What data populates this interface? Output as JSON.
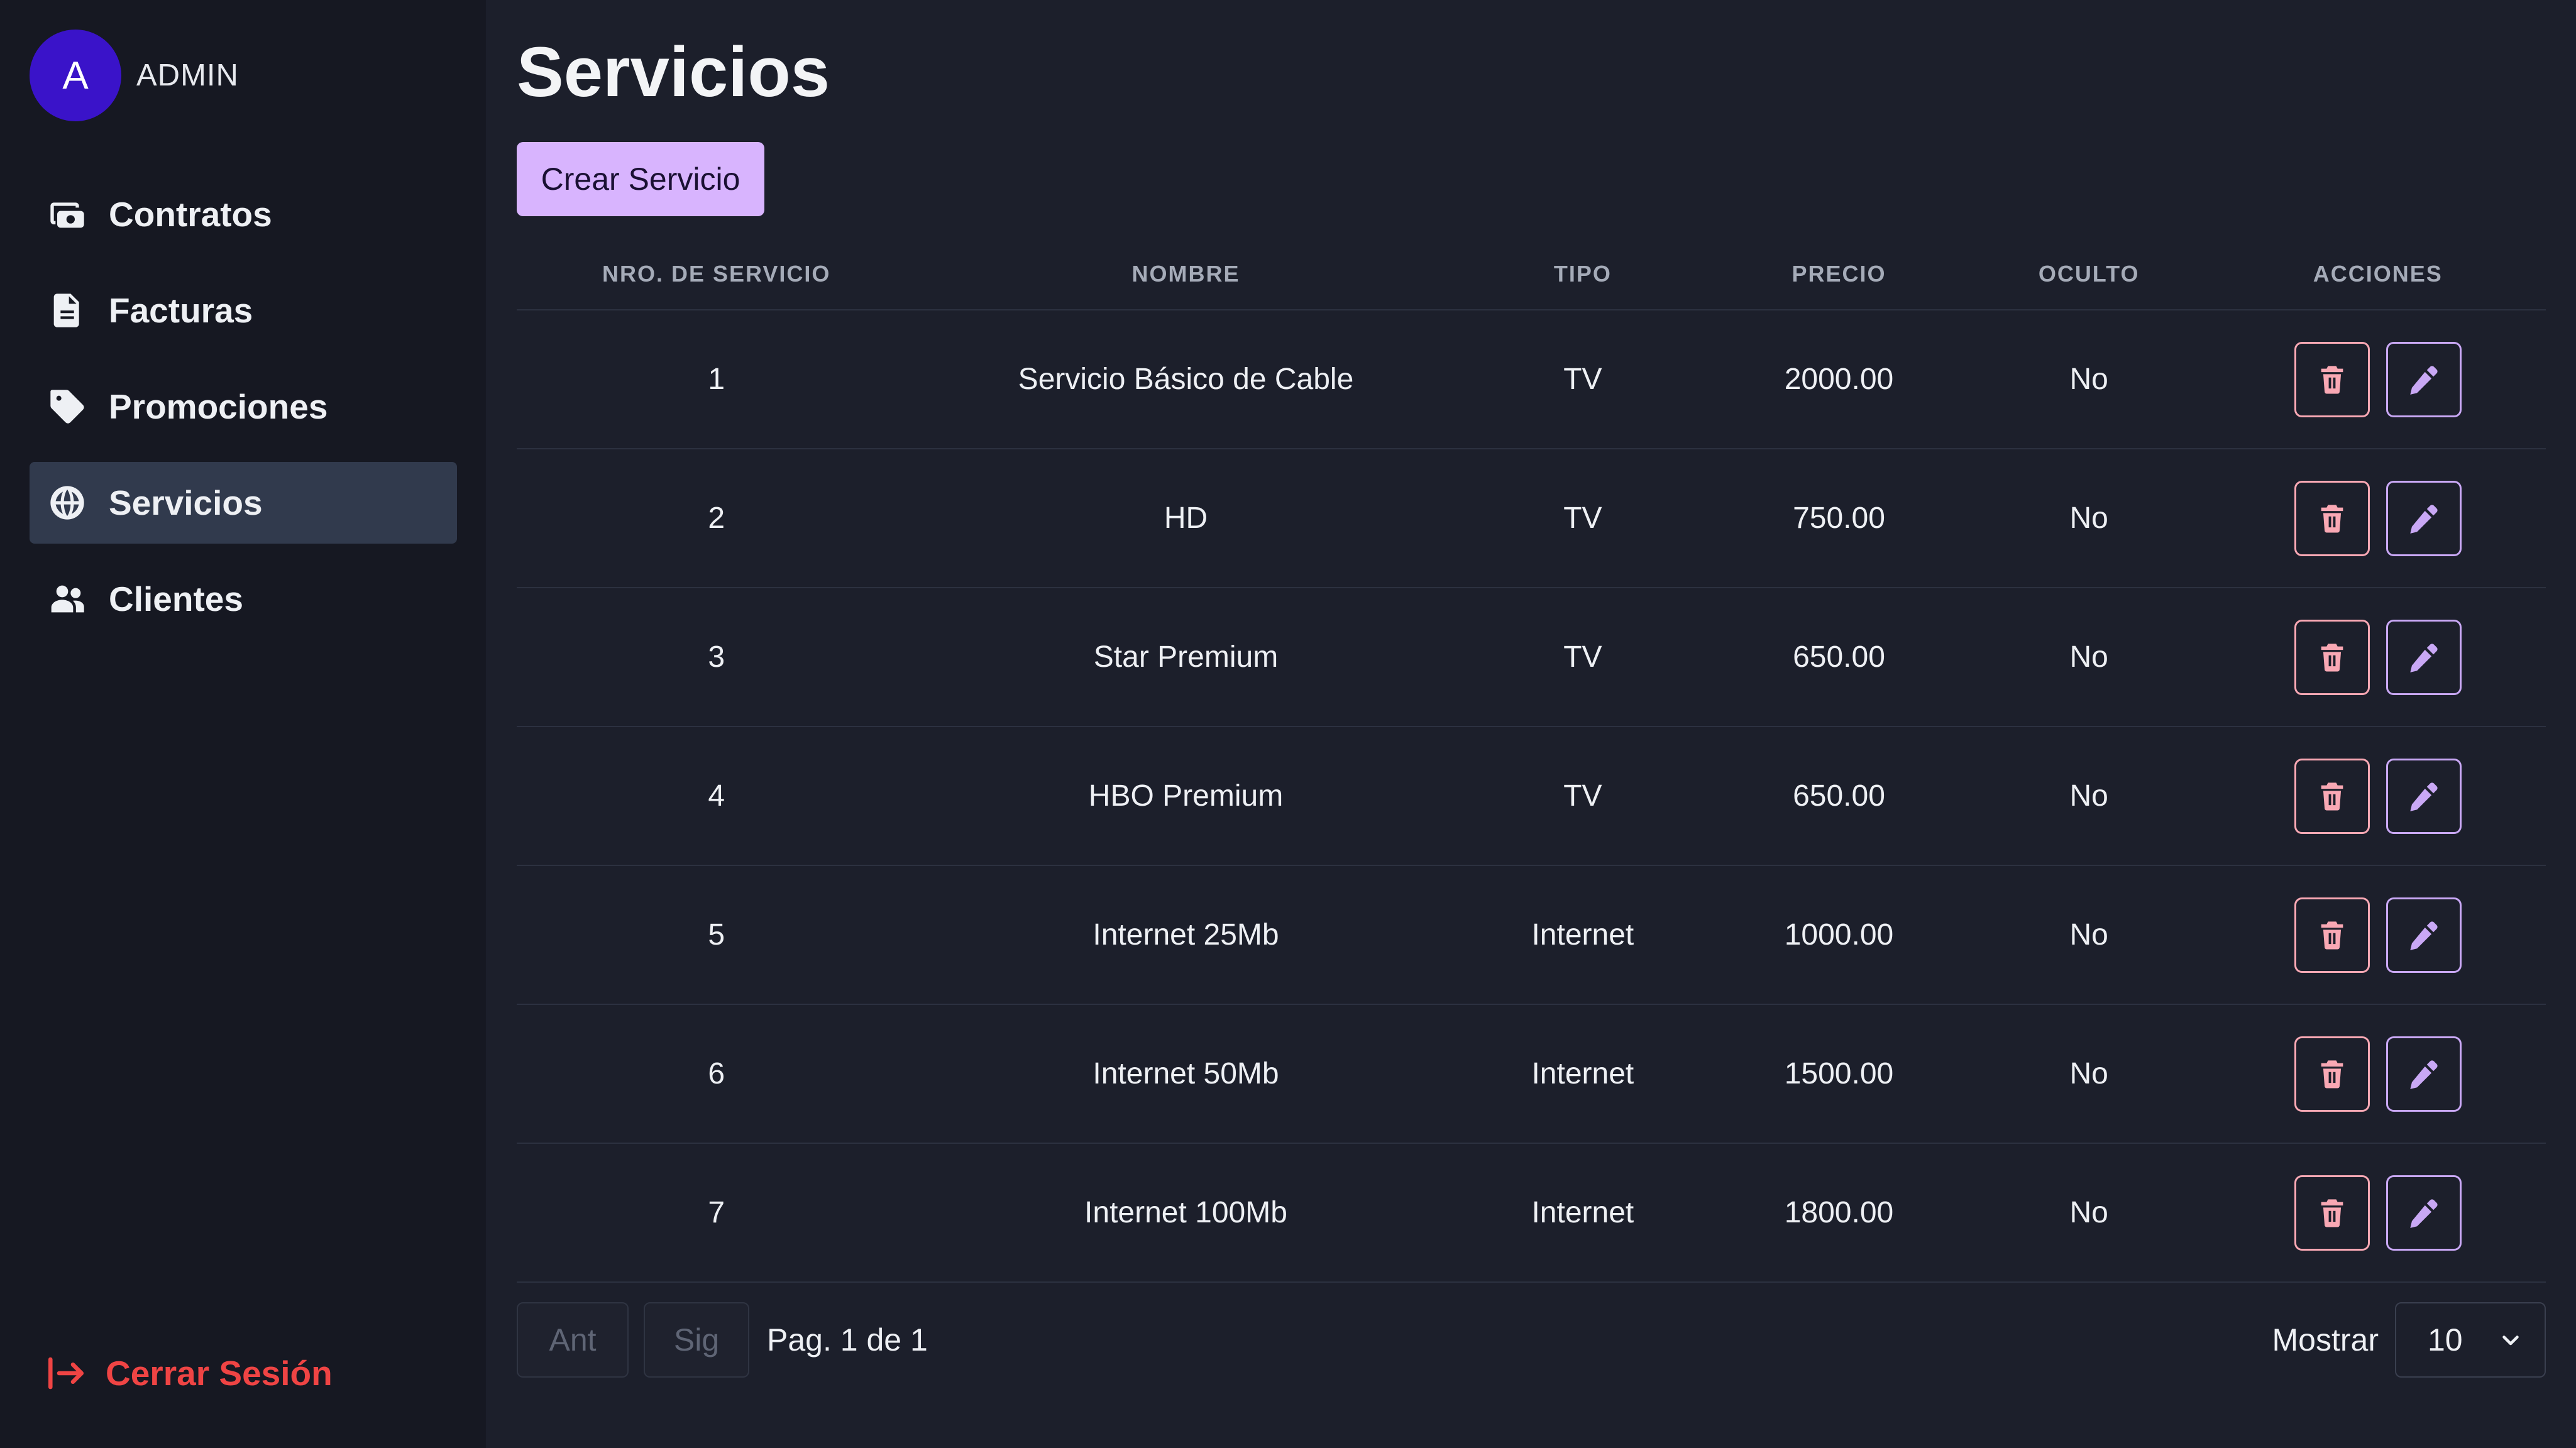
{
  "user": {
    "avatar_letter": "A",
    "name": "ADMIN"
  },
  "sidebar": {
    "items": [
      {
        "label": "Contratos",
        "icon": "contracts-icon",
        "active": false
      },
      {
        "label": "Facturas",
        "icon": "invoice-icon",
        "active": false
      },
      {
        "label": "Promociones",
        "icon": "tag-icon",
        "active": false
      },
      {
        "label": "Servicios",
        "icon": "globe-icon",
        "active": true
      },
      {
        "label": "Clientes",
        "icon": "users-icon",
        "active": false
      }
    ],
    "logout_label": "Cerrar Sesión"
  },
  "page": {
    "title": "Servicios",
    "create_button": "Crear Servicio"
  },
  "table": {
    "columns": [
      "NRO. DE SERVICIO",
      "NOMBRE",
      "TIPO",
      "PRECIO",
      "OCULTO",
      "ACCIONES"
    ],
    "rows": [
      {
        "id": "1",
        "name": "Servicio Básico de Cable",
        "type": "TV",
        "price": "2000.00",
        "hidden": "No"
      },
      {
        "id": "2",
        "name": "HD",
        "type": "TV",
        "price": "750.00",
        "hidden": "No"
      },
      {
        "id": "3",
        "name": "Star Premium",
        "type": "TV",
        "price": "650.00",
        "hidden": "No"
      },
      {
        "id": "4",
        "name": "HBO Premium",
        "type": "TV",
        "price": "650.00",
        "hidden": "No"
      },
      {
        "id": "5",
        "name": "Internet 25Mb",
        "type": "Internet",
        "price": "1000.00",
        "hidden": "No"
      },
      {
        "id": "6",
        "name": "Internet 50Mb",
        "type": "Internet",
        "price": "1500.00",
        "hidden": "No"
      },
      {
        "id": "7",
        "name": "Internet 100Mb",
        "type": "Internet",
        "price": "1800.00",
        "hidden": "No"
      }
    ]
  },
  "pagination": {
    "prev_label": "Ant",
    "next_label": "Sig",
    "info": "Pag. 1 de 1",
    "show_label": "Mostrar",
    "page_size": "10"
  },
  "colors": {
    "accent": "#d8b4fe",
    "danger": "#ef4444",
    "avatar": "#3a13c9",
    "active_nav": "#313a4d"
  }
}
